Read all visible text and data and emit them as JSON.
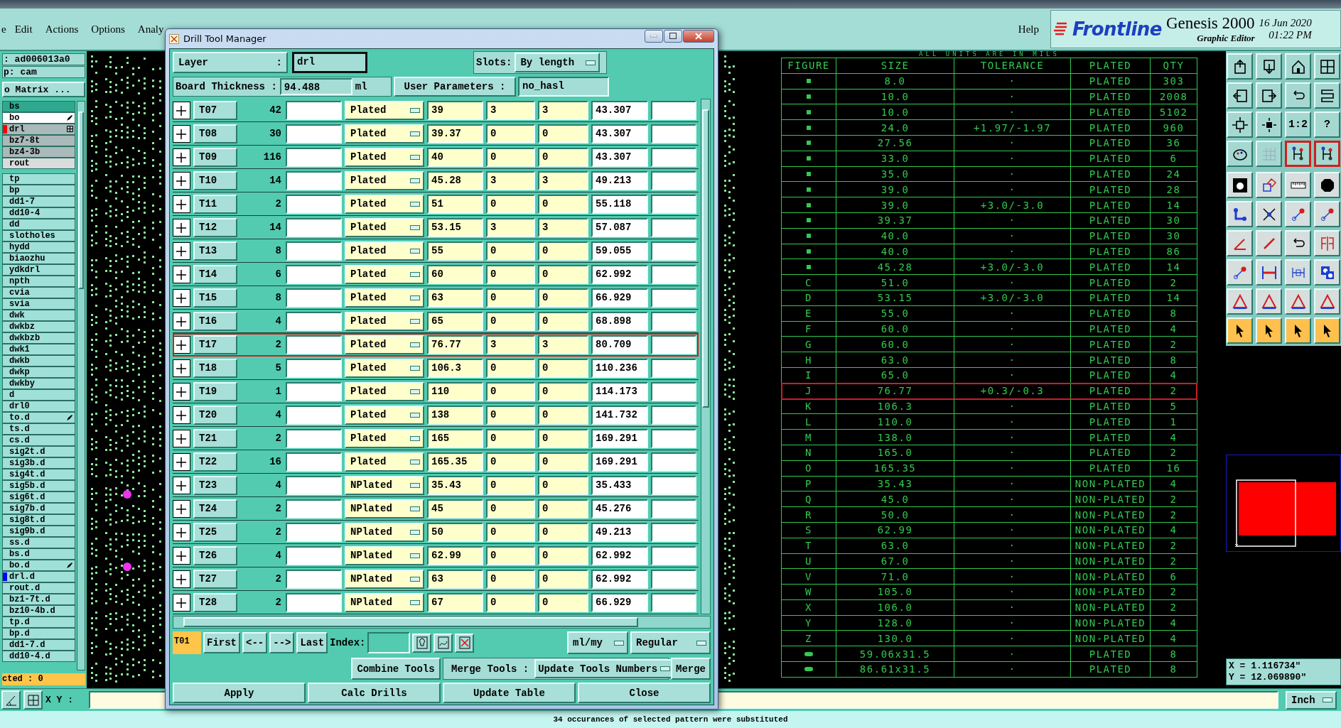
{
  "menu": [
    "e",
    "Edit",
    "Actions",
    "Options",
    "Analy"
  ],
  "help_menu": "Help",
  "brand": {
    "logo": "Frontline",
    "product": "Genesis 2000",
    "subtitle": "Graphic Editor",
    "date": "16 Jun 2020",
    "time": "01:22 PM"
  },
  "job_panel": {
    "job": ": ad006013a0",
    "step": "p: cam",
    "matrix_button": "o Matrix ...",
    "layer_groups": [
      {
        "layers": [
          {
            "name": "bs",
            "kind": "solder"
          },
          {
            "name": "bo",
            "kind": "work",
            "marked": true
          },
          {
            "name": "drl",
            "kind": "affected",
            "color": "#ff0000",
            "grid_mark": true
          },
          {
            "name": "bz7-8t",
            "kind": "affected"
          },
          {
            "name": "bz4-3b",
            "kind": "affected"
          },
          {
            "name": "rout",
            "kind": "rout"
          }
        ]
      },
      {
        "layers": [
          {
            "name": "tp",
            "kind": "misc"
          },
          {
            "name": "bp",
            "kind": "misc"
          },
          {
            "name": "dd1-7",
            "kind": "misc"
          },
          {
            "name": "dd10-4",
            "kind": "misc"
          },
          {
            "name": "dd",
            "kind": "misc"
          },
          {
            "name": "slotholes",
            "kind": "misc"
          },
          {
            "name": "hydd",
            "kind": "misc"
          },
          {
            "name": "biaozhu",
            "kind": "misc"
          },
          {
            "name": "ydkdrl",
            "kind": "misc"
          },
          {
            "name": "npth",
            "kind": "misc"
          },
          {
            "name": "cvia",
            "kind": "misc"
          },
          {
            "name": "svia",
            "kind": "misc"
          },
          {
            "name": "dwk",
            "kind": "misc"
          },
          {
            "name": "dwkbz",
            "kind": "misc"
          },
          {
            "name": "dwkbzb",
            "kind": "misc"
          },
          {
            "name": "dwk1",
            "kind": "misc"
          },
          {
            "name": "dwkb",
            "kind": "misc"
          },
          {
            "name": "dwkp",
            "kind": "misc"
          },
          {
            "name": "dwkby",
            "kind": "misc"
          },
          {
            "name": "d",
            "kind": "misc"
          },
          {
            "name": "drl0",
            "kind": "misc"
          },
          {
            "name": "to.d",
            "kind": "misc",
            "marked": true
          },
          {
            "name": "ts.d",
            "kind": "misc"
          },
          {
            "name": "cs.d",
            "kind": "misc"
          },
          {
            "name": "sig2t.d",
            "kind": "misc"
          },
          {
            "name": "sig3b.d",
            "kind": "misc"
          },
          {
            "name": "sig4t.d",
            "kind": "misc"
          },
          {
            "name": "sig5b.d",
            "kind": "misc"
          },
          {
            "name": "sig6t.d",
            "kind": "misc"
          },
          {
            "name": "sig7b.d",
            "kind": "misc"
          },
          {
            "name": "sig8t.d",
            "kind": "misc"
          },
          {
            "name": "sig9b.d",
            "kind": "misc"
          },
          {
            "name": "ss.d",
            "kind": "misc"
          },
          {
            "name": "bs.d",
            "kind": "misc"
          },
          {
            "name": "bo.d",
            "kind": "misc",
            "marked": true
          },
          {
            "name": "drl.d",
            "kind": "misc",
            "color": "#0000ff"
          },
          {
            "name": "rout.d",
            "kind": "misc"
          },
          {
            "name": "bz1-7t.d",
            "kind": "misc"
          },
          {
            "name": "bz10-4b.d",
            "kind": "misc"
          },
          {
            "name": "tp.d",
            "kind": "misc"
          },
          {
            "name": "bp.d",
            "kind": "misc"
          },
          {
            "name": "dd1-7.d",
            "kind": "misc"
          },
          {
            "name": "dd10-4.d",
            "kind": "misc"
          }
        ]
      }
    ],
    "selected_count": "cted : 0"
  },
  "drill_table": {
    "note": "ALL UNITS ARE IN MILS",
    "columns": [
      "FIGURE",
      "SIZE",
      "TOLERANCE",
      "PLATED",
      "QTY"
    ],
    "rows": [
      {
        "kind": "symbol",
        "size": "8.0",
        "tolerance": "·",
        "plated": "PLATED",
        "qty": "303",
        "selected": false
      },
      {
        "kind": "symbol",
        "size": "10.0",
        "tolerance": "·",
        "plated": "PLATED",
        "qty": "2008",
        "selected": false
      },
      {
        "kind": "symbol",
        "size": "10.0",
        "tolerance": "·",
        "plated": "PLATED",
        "qty": "5102",
        "selected": false
      },
      {
        "kind": "symbol",
        "size": "24.0",
        "tolerance": "+1.97/-1.97",
        "plated": "PLATED",
        "qty": "960",
        "selected": false
      },
      {
        "kind": "symbol",
        "size": "27.56",
        "tolerance": "·",
        "plated": "PLATED",
        "qty": "36",
        "selected": false
      },
      {
        "kind": "symbol",
        "size": "33.0",
        "tolerance": "·",
        "plated": "PLATED",
        "qty": "6",
        "selected": false
      },
      {
        "kind": "symbol",
        "size": "35.0",
        "tolerance": "·",
        "plated": "PLATED",
        "qty": "24",
        "selected": false
      },
      {
        "kind": "symbol",
        "size": "39.0",
        "tolerance": "·",
        "plated": "PLATED",
        "qty": "28",
        "selected": false
      },
      {
        "kind": "symbol",
        "size": "39.0",
        "tolerance": "+3.0/-3.0",
        "plated": "PLATED",
        "qty": "14",
        "selected": false
      },
      {
        "kind": "symbol",
        "size": "39.37",
        "tolerance": "·",
        "plated": "PLATED",
        "qty": "30",
        "selected": false
      },
      {
        "kind": "symbol",
        "size": "40.0",
        "tolerance": "·",
        "plated": "PLATED",
        "qty": "30",
        "selected": false
      },
      {
        "kind": "symbol",
        "size": "40.0",
        "tolerance": "·",
        "plated": "PLATED",
        "qty": "86",
        "selected": false
      },
      {
        "kind": "symbol",
        "size": "45.28",
        "tolerance": "+3.0/-3.0",
        "plated": "PLATED",
        "qty": "14",
        "selected": false
      },
      {
        "kind": "letter",
        "figure": "C",
        "size": "51.0",
        "tolerance": "·",
        "plated": "PLATED",
        "qty": "2",
        "selected": false
      },
      {
        "kind": "letter",
        "figure": "D",
        "size": "53.15",
        "tolerance": "+3.0/-3.0",
        "plated": "PLATED",
        "qty": "14",
        "selected": false
      },
      {
        "kind": "letter",
        "figure": "E",
        "size": "55.0",
        "tolerance": "·",
        "plated": "PLATED",
        "qty": "8",
        "selected": false
      },
      {
        "kind": "letter",
        "figure": "F",
        "size": "60.0",
        "tolerance": "·",
        "plated": "PLATED",
        "qty": "4",
        "selected": false
      },
      {
        "kind": "letter",
        "figure": "G",
        "size": "60.0",
        "tolerance": "·",
        "plated": "PLATED",
        "qty": "2",
        "selected": false
      },
      {
        "kind": "letter",
        "figure": "H",
        "size": "63.0",
        "tolerance": "·",
        "plated": "PLATED",
        "qty": "8",
        "selected": false
      },
      {
        "kind": "letter",
        "figure": "I",
        "size": "65.0",
        "tolerance": "·",
        "plated": "PLATED",
        "qty": "4",
        "selected": false
      },
      {
        "kind": "letter",
        "figure": "J",
        "size": "76.77",
        "tolerance": "+0.3/-0.3",
        "plated": "PLATED",
        "qty": "2",
        "selected": true
      },
      {
        "kind": "letter",
        "figure": "K",
        "size": "106.3",
        "tolerance": "·",
        "plated": "PLATED",
        "qty": "5",
        "selected": false
      },
      {
        "kind": "letter",
        "figure": "L",
        "size": "110.0",
        "tolerance": "·",
        "plated": "PLATED",
        "qty": "1",
        "selected": false
      },
      {
        "kind": "letter",
        "figure": "M",
        "size": "138.0",
        "tolerance": "·",
        "plated": "PLATED",
        "qty": "4",
        "selected": false
      },
      {
        "kind": "letter",
        "figure": "N",
        "size": "165.0",
        "tolerance": "·",
        "plated": "PLATED",
        "qty": "2",
        "selected": false
      },
      {
        "kind": "letter",
        "figure": "O",
        "size": "165.35",
        "tolerance": "·",
        "plated": "PLATED",
        "qty": "16",
        "selected": false
      },
      {
        "kind": "letter",
        "figure": "P",
        "size": "35.43",
        "tolerance": "·",
        "plated": "NON-PLATED",
        "qty": "4",
        "selected": false
      },
      {
        "kind": "letter",
        "figure": "Q",
        "size": "45.0",
        "tolerance": "·",
        "plated": "NON-PLATED",
        "qty": "2",
        "selected": false
      },
      {
        "kind": "letter",
        "figure": "R",
        "size": "50.0",
        "tolerance": "·",
        "plated": "NON-PLATED",
        "qty": "2",
        "selected": false
      },
      {
        "kind": "letter",
        "figure": "S",
        "size": "62.99",
        "tolerance": "·",
        "plated": "NON-PLATED",
        "qty": "4",
        "selected": false
      },
      {
        "kind": "letter",
        "figure": "T",
        "size": "63.0",
        "tolerance": "·",
        "plated": "NON-PLATED",
        "qty": "2",
        "selected": false
      },
      {
        "kind": "letter",
        "figure": "U",
        "size": "67.0",
        "tolerance": "·",
        "plated": "NON-PLATED",
        "qty": "2",
        "selected": false
      },
      {
        "kind": "letter",
        "figure": "V",
        "size": "71.0",
        "tolerance": "·",
        "plated": "NON-PLATED",
        "qty": "6",
        "selected": false
      },
      {
        "kind": "letter",
        "figure": "W",
        "size": "105.0",
        "tolerance": "·",
        "plated": "NON-PLATED",
        "qty": "2",
        "selected": false
      },
      {
        "kind": "letter",
        "figure": "X",
        "size": "106.0",
        "tolerance": "·",
        "plated": "NON-PLATED",
        "qty": "2",
        "selected": false
      },
      {
        "kind": "letter",
        "figure": "Y",
        "size": "128.0",
        "tolerance": "·",
        "plated": "NON-PLATED",
        "qty": "4",
        "selected": false
      },
      {
        "kind": "letter",
        "figure": "Z",
        "size": "130.0",
        "tolerance": "·",
        "plated": "NON-PLATED",
        "qty": "4",
        "selected": false
      },
      {
        "kind": "slot",
        "size": "59.06x31.5",
        "tolerance": "·",
        "plated": "PLATED",
        "qty": "8",
        "selected": false
      },
      {
        "kind": "slot",
        "size": "86.61x31.5",
        "tolerance": "·",
        "plated": "PLATED",
        "qty": "8",
        "selected": false
      }
    ]
  },
  "toolbar": {
    "buttons": [
      {
        "kind": "view",
        "on": false
      },
      {
        "kind": "view",
        "on": false
      },
      {
        "kind": "view",
        "on": false
      },
      {
        "kind": "view",
        "on": false
      },
      {
        "kind": "view",
        "on": false
      },
      {
        "kind": "view",
        "on": false
      },
      {
        "kind": "view",
        "on": false
      },
      {
        "kind": "view",
        "on": false
      },
      {
        "kind": "view",
        "on": false
      },
      {
        "kind": "view",
        "on": false
      },
      {
        "kind": "view",
        "on": false,
        "label": "1:2"
      },
      {
        "kind": "view",
        "on": false,
        "label": "?"
      },
      {
        "kind": "view",
        "on": false
      },
      {
        "kind": "view",
        "on": false
      },
      {
        "kind": "view",
        "on": true
      },
      {
        "kind": "view",
        "on": true
      },
      {
        "kind": "edit",
        "on": false
      },
      {
        "kind": "edit",
        "on": false
      },
      {
        "kind": "edit",
        "on": false
      },
      {
        "kind": "edit",
        "on": false
      },
      {
        "kind": "edit",
        "on": false
      },
      {
        "kind": "edit",
        "on": false
      },
      {
        "kind": "edit",
        "on": false
      },
      {
        "kind": "edit",
        "on": false
      },
      {
        "kind": "edit",
        "on": false
      },
      {
        "kind": "edit",
        "on": false
      },
      {
        "kind": "edit",
        "on": false
      },
      {
        "kind": "edit",
        "on": false
      },
      {
        "kind": "edit",
        "on": false
      },
      {
        "kind": "edit",
        "on": false
      },
      {
        "kind": "edit",
        "on": false
      },
      {
        "kind": "edit",
        "on": false
      },
      {
        "kind": "edit",
        "on": false
      },
      {
        "kind": "edit",
        "on": false
      },
      {
        "kind": "edit",
        "on": false
      },
      {
        "kind": "edit",
        "on": false
      },
      {
        "kind": "select",
        "on": false
      },
      {
        "kind": "select",
        "on": false
      },
      {
        "kind": "select",
        "on": false
      },
      {
        "kind": "select",
        "on": false
      }
    ]
  },
  "coordinates": {
    "x": "X = 1.116734\"",
    "y": "Y = 12.069890\""
  },
  "command_bar": {
    "label": "X Y :",
    "units": "Inch"
  },
  "status_bar": "34 occurances of selected pattern were substituted",
  "dialog": {
    "title": "Drill Tool Manager",
    "layer_label": "Layer",
    "layer_colon": ":",
    "layer": "drl",
    "slots_label": "Slots:",
    "slots": "By length",
    "thickness_label": "Board Thickness :",
    "thickness": "94.488",
    "thickness_unit": "ml",
    "user_params_button": "User Parameters :",
    "user_params": "no_hasl",
    "tools": [
      {
        "tool": "T07",
        "count": "42",
        "type": "Plated",
        "finish": "39",
        "tol_plus": "3",
        "tol_minus": "3",
        "drill": "43.307",
        "selected": false
      },
      {
        "tool": "T08",
        "count": "30",
        "type": "Plated",
        "finish": "39.37",
        "tol_plus": "0",
        "tol_minus": "0",
        "drill": "43.307",
        "selected": false
      },
      {
        "tool": "T09",
        "count": "116",
        "type": "Plated",
        "finish": "40",
        "tol_plus": "0",
        "tol_minus": "0",
        "drill": "43.307",
        "selected": false
      },
      {
        "tool": "T10",
        "count": "14",
        "type": "Plated",
        "finish": "45.28",
        "tol_plus": "3",
        "tol_minus": "3",
        "drill": "49.213",
        "selected": false
      },
      {
        "tool": "T11",
        "count": "2",
        "type": "Plated",
        "finish": "51",
        "tol_plus": "0",
        "tol_minus": "0",
        "drill": "55.118",
        "selected": false
      },
      {
        "tool": "T12",
        "count": "14",
        "type": "Plated",
        "finish": "53.15",
        "tol_plus": "3",
        "tol_minus": "3",
        "drill": "57.087",
        "selected": false
      },
      {
        "tool": "T13",
        "count": "8",
        "type": "Plated",
        "finish": "55",
        "tol_plus": "0",
        "tol_minus": "0",
        "drill": "59.055",
        "selected": false
      },
      {
        "tool": "T14",
        "count": "6",
        "type": "Plated",
        "finish": "60",
        "tol_plus": "0",
        "tol_minus": "0",
        "drill": "62.992",
        "selected": false
      },
      {
        "tool": "T15",
        "count": "8",
        "type": "Plated",
        "finish": "63",
        "tol_plus": "0",
        "tol_minus": "0",
        "drill": "66.929",
        "selected": false
      },
      {
        "tool": "T16",
        "count": "4",
        "type": "Plated",
        "finish": "65",
        "tol_plus": "0",
        "tol_minus": "0",
        "drill": "68.898",
        "selected": false
      },
      {
        "tool": "T17",
        "count": "2",
        "type": "Plated",
        "finish": "76.77",
        "tol_plus": "3",
        "tol_minus": "3",
        "drill": "80.709",
        "selected": true
      },
      {
        "tool": "T18",
        "count": "5",
        "type": "Plated",
        "finish": "106.3",
        "tol_plus": "0",
        "tol_minus": "0",
        "drill": "110.236",
        "selected": false
      },
      {
        "tool": "T19",
        "count": "1",
        "type": "Plated",
        "finish": "110",
        "tol_plus": "0",
        "tol_minus": "0",
        "drill": "114.173",
        "selected": false
      },
      {
        "tool": "T20",
        "count": "4",
        "type": "Plated",
        "finish": "138",
        "tol_plus": "0",
        "tol_minus": "0",
        "drill": "141.732",
        "selected": false
      },
      {
        "tool": "T21",
        "count": "2",
        "type": "Plated",
        "finish": "165",
        "tol_plus": "0",
        "tol_minus": "0",
        "drill": "169.291",
        "selected": false
      },
      {
        "tool": "T22",
        "count": "16",
        "type": "Plated",
        "finish": "165.35",
        "tol_plus": "0",
        "tol_minus": "0",
        "drill": "169.291",
        "selected": false
      },
      {
        "tool": "T23",
        "count": "4",
        "type": "NPlated",
        "finish": "35.43",
        "tol_plus": "0",
        "tol_minus": "0",
        "drill": "35.433",
        "selected": false
      },
      {
        "tool": "T24",
        "count": "2",
        "type": "NPlated",
        "finish": "45",
        "tol_plus": "0",
        "tol_minus": "0",
        "drill": "45.276",
        "selected": false
      },
      {
        "tool": "T25",
        "count": "2",
        "type": "NPlated",
        "finish": "50",
        "tol_plus": "0",
        "tol_minus": "0",
        "drill": "49.213",
        "selected": false
      },
      {
        "tool": "T26",
        "count": "4",
        "type": "NPlated",
        "finish": "62.99",
        "tol_plus": "0",
        "tol_minus": "0",
        "drill": "62.992",
        "selected": false
      },
      {
        "tool": "T27",
        "count": "2",
        "type": "NPlated",
        "finish": "63",
        "tol_plus": "0",
        "tol_minus": "0",
        "drill": "62.992",
        "selected": false
      },
      {
        "tool": "T28",
        "count": "2",
        "type": "NPlated",
        "finish": "67",
        "tol_plus": "0",
        "tol_minus": "0",
        "drill": "66.929",
        "selected": false
      }
    ],
    "current_tool": "T01",
    "nav_buttons": [
      "First",
      "<--",
      "-->",
      "Last"
    ],
    "index_label": "Index:",
    "units": "ml/my",
    "mode": "Regular",
    "combine_button": "Combine Tools",
    "merge_label": "Merge Tools :",
    "merge_mode": "Update Tools Numbers",
    "merge_button": "Merge",
    "actions": [
      "Apply",
      "Calc Drills",
      "Update Table",
      "Close"
    ]
  }
}
